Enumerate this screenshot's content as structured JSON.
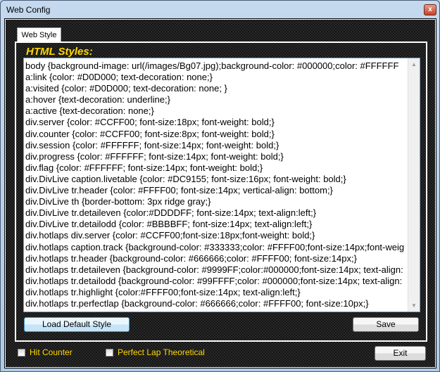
{
  "window": {
    "title": "Web Config",
    "close_label": "x"
  },
  "tab": {
    "label": "Web Style"
  },
  "section": {
    "title": "HTML Styles:"
  },
  "styles_text": [
    "body {background-image: url(/images/Bg07.jpg);background-color: #000000;color: #FFFFFF",
    "a:link {color: #D0D000; text-decoration: none;}",
    "a:visited {color: #D0D000; text-decoration: none; }",
    "a:hover {text-decoration: underline;}",
    "a:active {text-decoration: none;}",
    "div.server {color: #CCFF00; font-size:18px; font-weight: bold;}",
    "div.counter {color: #CCFF00; font-size:8px; font-weight: bold;}",
    "div.session {color: #FFFFFF; font-size:14px; font-weight: bold;}",
    "div.progress {color: #FFFFFF; font-size:14px; font-weight: bold;}",
    "div.flag {color: #FFFFFF; font-size:14px; font-weight: bold;}",
    "div.DivLive caption.livetable {color: #DC9155; font-size:16px; font-weight: bold;}",
    "div.DivLive tr.header {color: #FFFF00; font-size:14px; vertical-align: bottom;}",
    "div.DivLive th {border-bottom: 3px ridge gray;}",
    "div.DivLive tr.detaileven {color:#DDDDFF; font-size:14px; text-align:left;}",
    "div.DivLive tr.detailodd {color: #BBBBFF; font-size:14px; text-align:left;}",
    "div.hotlaps div.server {color: #CCFF00;font-size:18px;font-weight: bold;}",
    "div.hotlaps caption.track {background-color: #333333;color: #FFFF00;font-size:14px;font-weig",
    "div.hotlaps tr.header {background-color: #666666;color: #FFFF00; font-size:14px;}",
    "div.hotlaps tr.detaileven {background-color: #9999FF;color:#000000;font-size:14px; text-align:",
    "div.hotlaps tr.detailodd {background-color: #99FFFF;color: #000000;font-size:14px; text-align:",
    "div.hotlaps tr.highlight {color:#FFFF00;font-size:14px; text-align:left;}",
    "div.hotlaps tr.perfectlap {background-color: #666666;color: #FFFF00; font-size:10px;}"
  ],
  "buttons": {
    "load_default": "Load Default Style",
    "save": "Save",
    "exit": "Exit"
  },
  "checkboxes": [
    {
      "label": "Hit Counter",
      "checked": false
    },
    {
      "label": "Perfect Lap Theoretical",
      "checked": false
    }
  ],
  "colors": {
    "accent": "#FFD700"
  },
  "icons": {
    "scroll_up": "▲",
    "scroll_down": "▼"
  }
}
